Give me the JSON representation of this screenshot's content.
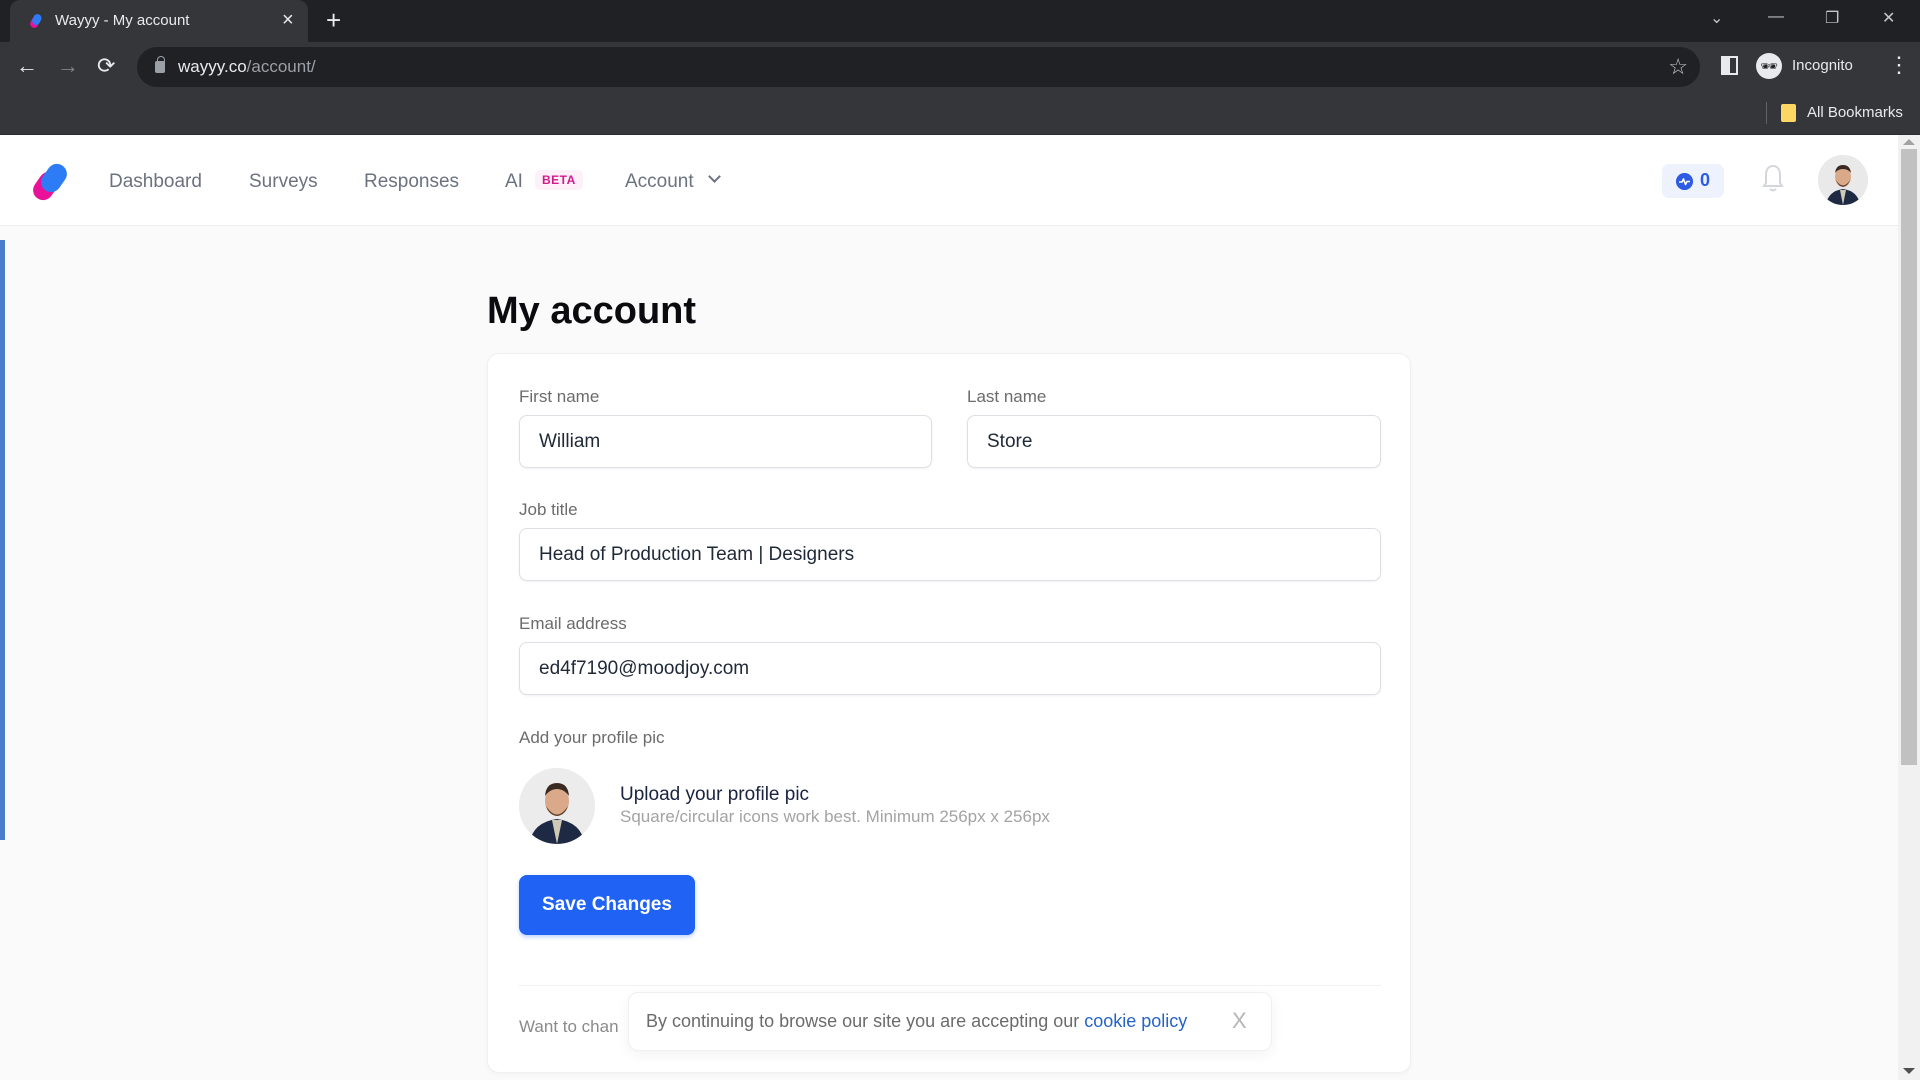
{
  "browser": {
    "tab_title": "Wayyy - My account",
    "tab_close": "×",
    "new_tab": "+",
    "url_host": "wayyy.co",
    "url_path": "/account/",
    "profile_label": "Incognito",
    "bookmarks_label": "All Bookmarks",
    "window_controls": {
      "tab_search": "⌄",
      "minimize": "—",
      "restore": "❐",
      "close": "✕"
    },
    "nav": {
      "back": "←",
      "forward": "→",
      "reload": "⟳"
    },
    "star": "☆",
    "menu": "⋮",
    "incognito_glyph": "🕶"
  },
  "header": {
    "nav_items": [
      {
        "label": "Dashboard"
      },
      {
        "label": "Surveys"
      },
      {
        "label": "Responses"
      },
      {
        "label": "AI"
      },
      {
        "label": "Account"
      }
    ],
    "ai_badge": "BETA",
    "activity_count": "0",
    "colors": {
      "brand_blue": "#2d7cf6",
      "brand_pink": "#e8119a",
      "badge_pink": "#d11a8a"
    }
  },
  "page": {
    "title": "My account",
    "form": {
      "first_name": {
        "label": "First name",
        "value": "William"
      },
      "last_name": {
        "label": "Last name",
        "value": "Store"
      },
      "job_title": {
        "label": "Job title",
        "value": "Head of Production Team | Designers"
      },
      "email": {
        "label": "Email address",
        "value": "ed4f7190@moodjoy.com"
      },
      "profile_pic": {
        "label": "Add your profile pic",
        "upload_title": "Upload your profile pic",
        "upload_hint": "Square/circular icons work best. Minimum 256px x 256px"
      },
      "save_label": "Save Changes"
    },
    "change_prompt_partial": "Want to chan",
    "primary_color": "#1f62f4"
  },
  "cookie_banner": {
    "text": "By continuing to browse our site you are accepting our ",
    "link_label": "cookie policy",
    "close": "X"
  }
}
